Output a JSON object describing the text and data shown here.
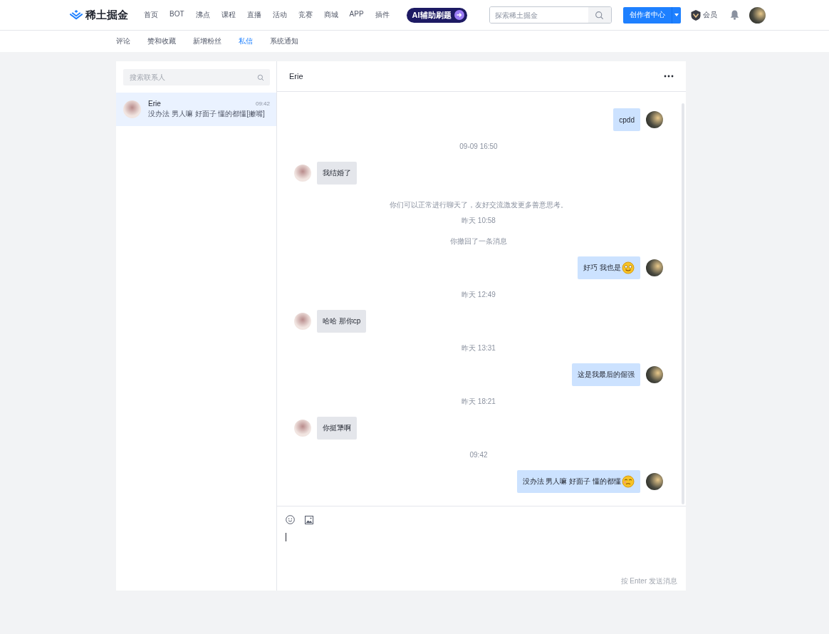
{
  "header": {
    "logo": "稀土掘金",
    "nav": [
      {
        "label": "首页",
        "selected": false
      },
      {
        "label": "BOT",
        "selected": false
      },
      {
        "label": "沸点",
        "selected": false
      },
      {
        "label": "课程",
        "selected": false
      },
      {
        "label": "直播",
        "selected": false
      },
      {
        "label": "活动",
        "selected": false
      },
      {
        "label": "竞赛",
        "selected": false
      },
      {
        "label": "商城",
        "selected": false
      },
      {
        "label": "APP",
        "selected": false
      },
      {
        "label": "插件",
        "selected": false
      }
    ],
    "ai_badge": "AI辅助刷题",
    "search": {
      "placeholder": "探索稀土掘金"
    },
    "creator_button": "创作者中心",
    "member": "会员"
  },
  "subnav": [
    {
      "label": "评论",
      "selected": false
    },
    {
      "label": "赞和收藏",
      "selected": false
    },
    {
      "label": "新增粉丝",
      "selected": false
    },
    {
      "label": "私信",
      "selected": true
    },
    {
      "label": "系统通知",
      "selected": false
    }
  ],
  "contacts": {
    "search": {
      "placeholder": "搜索联系人"
    },
    "items": [
      {
        "name": "Erie",
        "time": "09:42",
        "preview": "没办法 男人嘛 好面子 懂的都懂[撇嘴]",
        "selected": true
      }
    ]
  },
  "chat": {
    "title": "Erie",
    "messages": [
      {
        "kind": "out",
        "text": "cpdd"
      },
      {
        "kind": "time",
        "text": "09-09 16:50"
      },
      {
        "kind": "in",
        "text": "我结婚了"
      },
      {
        "kind": "notice",
        "text": "你们可以正常进行聊天了，友好交流激发更多善意思考。"
      },
      {
        "kind": "time",
        "text": "昨天 10:58"
      },
      {
        "kind": "notice",
        "text": "你撤回了一条消息"
      },
      {
        "kind": "out",
        "text": "好巧 我也是",
        "emoji": {
          "kind": "smile"
        }
      },
      {
        "kind": "time",
        "text": "昨天 12:49"
      },
      {
        "kind": "in",
        "text": "哈哈 那你cp"
      },
      {
        "kind": "time",
        "text": "昨天 13:31"
      },
      {
        "kind": "out",
        "text": "这是我最后的倔强"
      },
      {
        "kind": "time",
        "text": "昨天 18:21"
      },
      {
        "kind": "in",
        "text": "你挺犟啊"
      },
      {
        "kind": "time",
        "text": "09:42"
      },
      {
        "kind": "out",
        "text": "没办法 男人嘛 好面子 懂的都懂",
        "emoji": {
          "kind": "pout"
        }
      }
    ],
    "hint": "按 Enter 发送消息"
  }
}
